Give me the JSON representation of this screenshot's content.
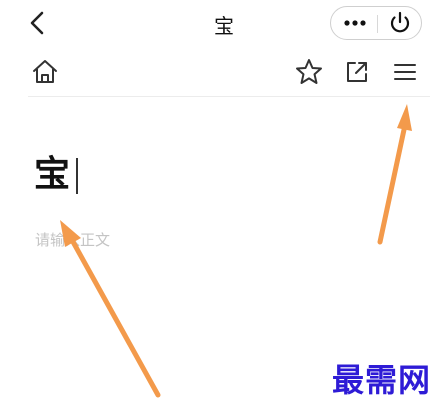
{
  "header": {
    "title": "宝"
  },
  "editor": {
    "doc_title": "宝",
    "body_placeholder": "请输入正文"
  },
  "watermark": {
    "text": "最需网"
  },
  "colors": {
    "annotation_arrow": "#f39a4b",
    "watermark": "#2e1bd6",
    "placeholder": "#c4c4c4"
  },
  "icons": {
    "back": "chevron-left-icon",
    "more": "more-dots-icon",
    "power": "power-icon",
    "home": "home-icon",
    "star": "star-icon",
    "share": "share-icon",
    "menu": "menu-icon"
  }
}
